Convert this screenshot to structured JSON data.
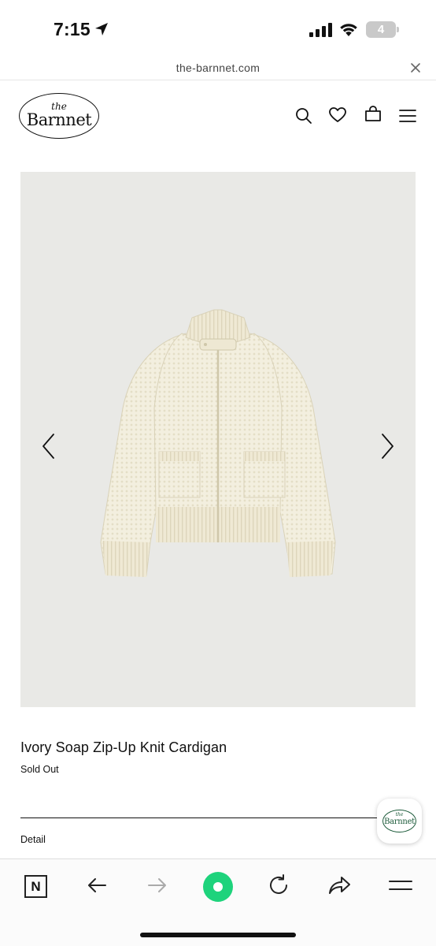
{
  "status_bar": {
    "time": "7:15",
    "battery_level": "4",
    "icons": [
      "location-arrow-icon",
      "cellular-signal-icon",
      "wifi-icon",
      "battery-icon"
    ]
  },
  "browser": {
    "url": "the-barnnet.com",
    "close_icon": "close-icon"
  },
  "site_header": {
    "logo": {
      "small": "the",
      "name": "Barnnet"
    },
    "icons": [
      "search-icon",
      "heart-icon",
      "shopping-bag-icon",
      "menu-icon"
    ]
  },
  "product": {
    "image_alt_icons": [
      "chevron-left-icon",
      "chevron-right-icon"
    ],
    "title": "Ivory Soap Zip-Up Knit Cardigan",
    "status": "Sold Out",
    "detail_label": "Detail"
  },
  "floating_badge": {
    "small": "the",
    "name": "Barnnet"
  },
  "toolbar": {
    "n_label": "N",
    "icons": [
      "n-app-icon",
      "back-arrow-icon",
      "forward-arrow-icon",
      "record-icon",
      "reload-icon",
      "share-icon",
      "menu-icon"
    ]
  },
  "colors": {
    "image_background": "#e9e9e6",
    "sweater": "#f3efdf",
    "accent_green": "#1ed37c",
    "badge_green": "#1c5b3a"
  }
}
